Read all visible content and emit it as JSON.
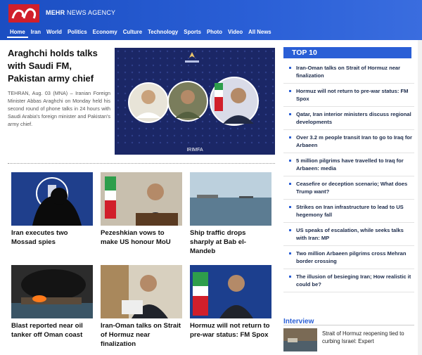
{
  "header": {
    "brand_bold": "MEHR",
    "brand_rest": "NEWS AGENCY",
    "nav": [
      "Home",
      "Iran",
      "World",
      "Politics",
      "Economy",
      "Culture",
      "Technology",
      "Sports",
      "Photo",
      "Video",
      "All News"
    ]
  },
  "lead": {
    "title": "Araghchi holds talks with Saudi FM, Pakistan army chief",
    "text": "TEHRAN, Aug. 03 (MNA) – Iranian Foreign Minister Abbas Araghchi on Monday held his second round of phone talks in 24 hours with Saudi Arabia's foreign minister and Pakistan's army chief.",
    "image_caption": "IRIMFA"
  },
  "grid": [
    {
      "title": "Iran executes two Mossad spies"
    },
    {
      "title": "Pezeshkian vows to make US honour MoU"
    },
    {
      "title": "Ship traffic drops sharply at Bab el-Mandeb"
    },
    {
      "title": "Blast reported near oil tanker off Oman coast"
    },
    {
      "title": "Iran-Oman talks on Strait of Hormuz near finalization"
    },
    {
      "title": "Hormuz will not return to pre-war status: FM Spox"
    }
  ],
  "top10": {
    "heading": "TOP 10",
    "items": [
      "Iran-Oman talks on Strait of Hormuz near finalization",
      "Hormuz will not return to pre-war status: FM Spox",
      "Qatar, Iran interior ministers discuss regional developments",
      "Over 3.2 m people transit Iran to go to Iraq for Arbaeen",
      "5 million pilgrims have travelled to Iraq for Arbaeen: media",
      "Ceasefire or deception scenario; What does Trump want?",
      "Strikes on Iran infrastructure to lead to US hegemony fall",
      "US speaks of escalation, while seeks talks with Iran: MP",
      "Two million Arbaeen pilgrims cross Mehran border crossing",
      "The illusion of besieging Iran; How realistic it could be?"
    ]
  },
  "interview": {
    "heading": "Interview",
    "item": "Strait of Hormuz reopening tied to curbing Israel: Expert"
  },
  "colors": {
    "brand_blue": "#2a5fd6",
    "logo_red": "#d11f2b"
  }
}
